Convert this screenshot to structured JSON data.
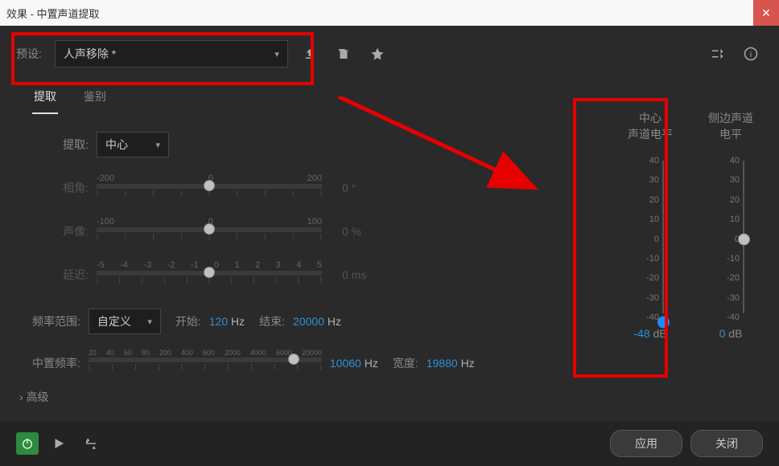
{
  "window": {
    "title": "效果 - 中置声道提取"
  },
  "preset": {
    "label": "预设:",
    "value": "人声移除 *"
  },
  "tabs": {
    "extract": "提取",
    "identify": "鉴别"
  },
  "extract": {
    "label": "提取:",
    "value": "中心",
    "angle_label": "相角:",
    "angle_ticks": [
      "-200",
      "0",
      "200"
    ],
    "angle_val": "0 °",
    "pan_label": "声像:",
    "pan_ticks": [
      "-100",
      "0",
      "100"
    ],
    "pan_val": "0 %",
    "delay_label": "延迟:",
    "delay_ticks": [
      "-5",
      "-4",
      "-3",
      "-2",
      "-1",
      "0",
      "1",
      "2",
      "3",
      "4",
      "5"
    ],
    "delay_val": "0 ms"
  },
  "freq": {
    "range_label": "频率范围:",
    "range_value": "自定义",
    "start_label": "开始:",
    "start_value": "120",
    "start_unit": "Hz",
    "end_label": "结束:",
    "end_value": "20000",
    "end_unit": "Hz",
    "center_label": "中置频率:",
    "center_ticks": [
      "20",
      "40",
      "60",
      "80",
      "200",
      "400",
      "600",
      "2000",
      "4000",
      "6000",
      "20000"
    ],
    "center_value": "10060",
    "center_unit": "Hz",
    "width_label": "宽度:",
    "width_value": "19880",
    "width_unit": "Hz"
  },
  "meters": {
    "center_label_1": "中心",
    "center_label_2": "声道电平",
    "side_label_1": "侧边声道",
    "side_label_2": "电平",
    "ticks": [
      "40",
      "30",
      "20",
      "10",
      "0",
      "-10",
      "-20",
      "-30",
      "-40"
    ],
    "center_value": "-48",
    "side_value": "0",
    "unit": "dB"
  },
  "advanced": "高级",
  "footer": {
    "apply": "应用",
    "close": "关闭"
  }
}
